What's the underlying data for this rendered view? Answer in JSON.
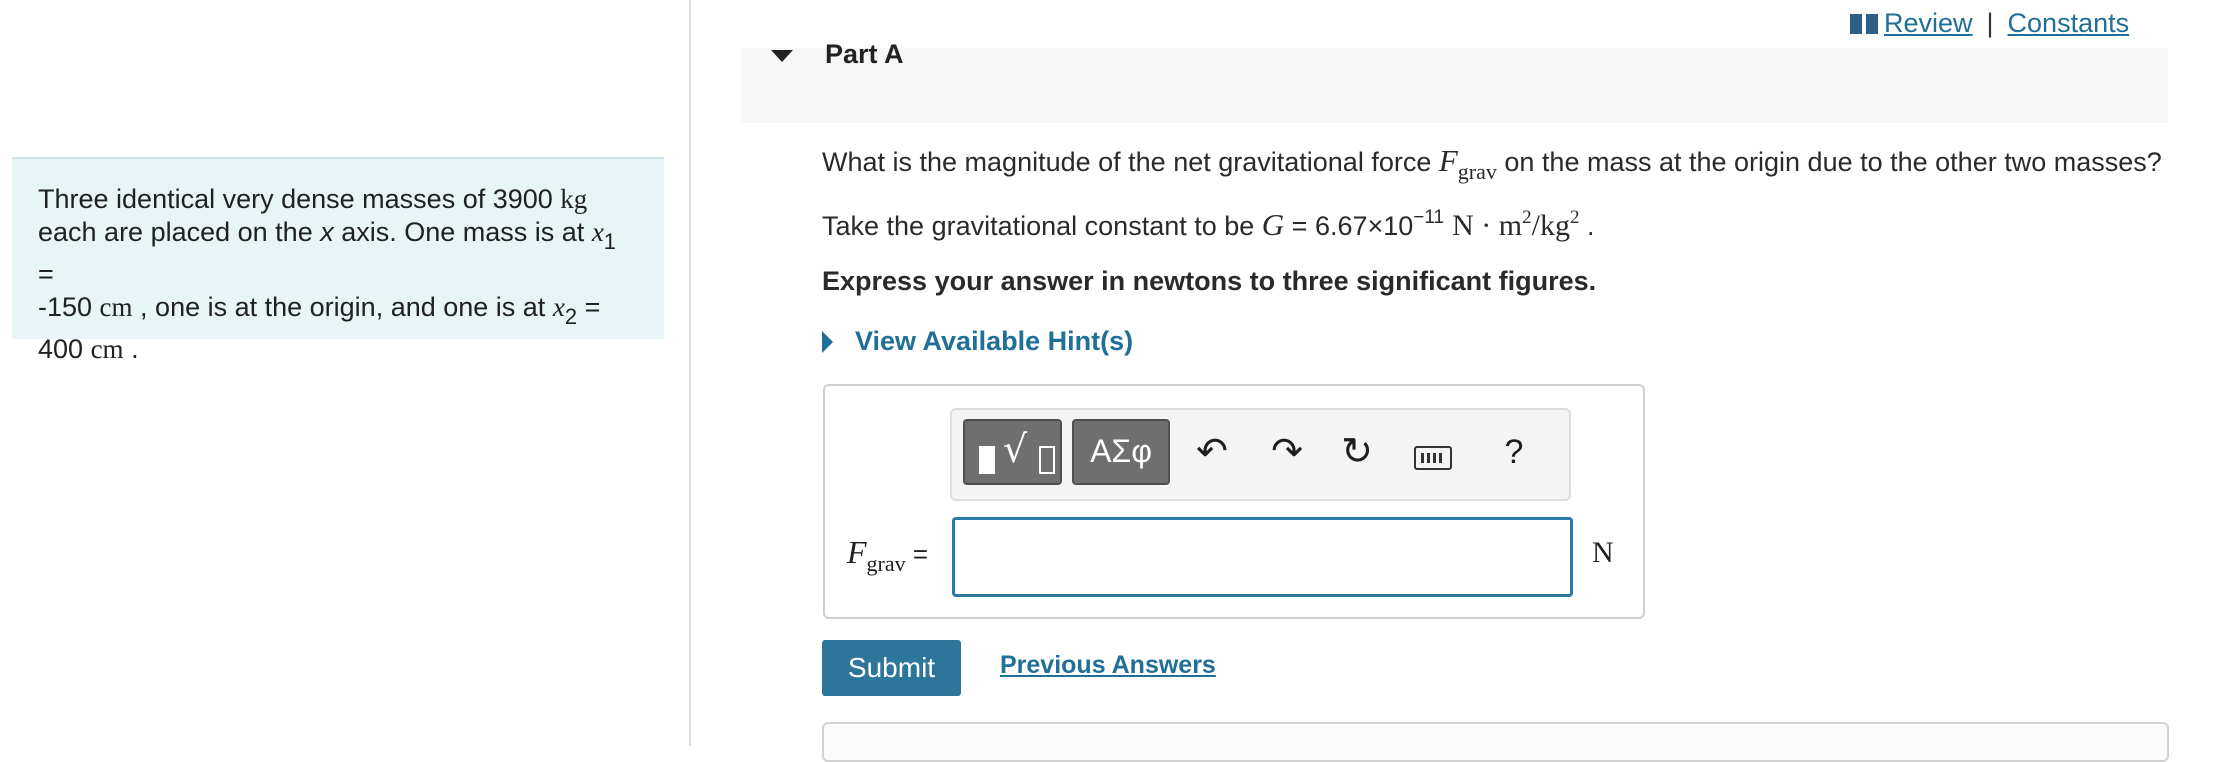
{
  "top_links": {
    "review": "Review",
    "separator": "|",
    "constants": "Constants"
  },
  "problem": {
    "t1": "Three identical very dense masses of 3900 ",
    "u_kg": "kg",
    "t2": "each are placed on the ",
    "x_axis": "x",
    "t3": " axis. One mass is at ",
    "x1": "x",
    "x1_sub": "1",
    "eq": " =",
    "t4": "-150 ",
    "u_cm": "cm",
    "t5": " , one is at the origin, and one is at ",
    "x2": "x",
    "x2_sub": "2",
    "t6": "400 ",
    "u_cm2": "cm",
    "t7": " ."
  },
  "part": {
    "title": "Part A"
  },
  "question": {
    "l1a": "What is the magnitude of the net gravitational force ",
    "F": "F",
    "grav": "grav",
    "l1b": " on the mass at the origin due to the other two masses?",
    "l2a": "Take the gravitational constant to be ",
    "G": "G",
    "l2b": " = 6.67×10",
    "exp": "−11",
    "unit_n": "N · m",
    "exp2": "2",
    "unit_kg": "/kg",
    "exp3": "2",
    "period": " .",
    "l3": "Express your answer in newtons to three significant figures."
  },
  "hints": {
    "label": "View Available Hint(s)"
  },
  "toolbar": {
    "symbols": "ΑΣφ",
    "undo": "↶",
    "redo": "↷",
    "reset": "↻",
    "help": "?"
  },
  "answer": {
    "F": "F",
    "sub": "grav",
    "equals": " =",
    "value": "",
    "unit": "N"
  },
  "actions": {
    "submit": "Submit",
    "previous": "Previous Answers"
  }
}
